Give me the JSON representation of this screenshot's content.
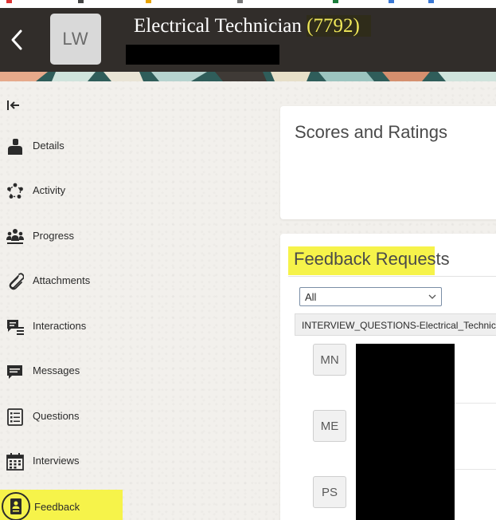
{
  "header": {
    "avatar_initials": "LW",
    "job_title": "Electrical Technician",
    "job_id": "7792",
    "paren_open": "(",
    "paren_close": ")"
  },
  "sidebar": {
    "items": [
      {
        "label": "Details",
        "icon": "person-icon"
      },
      {
        "label": "Activity",
        "icon": "activity-icon"
      },
      {
        "label": "Progress",
        "icon": "people-icon"
      },
      {
        "label": "Attachments",
        "icon": "paperclip-icon"
      },
      {
        "label": "Interactions",
        "icon": "interactions-icon"
      },
      {
        "label": "Messages",
        "icon": "message-icon"
      },
      {
        "label": "Questions",
        "icon": "checklist-icon"
      },
      {
        "label": "Interviews",
        "icon": "calendar-icon"
      },
      {
        "label": "Feedback",
        "icon": "feedback-icon"
      }
    ]
  },
  "scores": {
    "title": "Scores and Ratings"
  },
  "feedback": {
    "title": "Feedback Requests",
    "filter_value": "All",
    "question_label": "INTERVIEW_QUESTIONS-Electrical_Technician",
    "reviewers": [
      "MN",
      "ME",
      "PS"
    ]
  },
  "colors": {
    "header_bg": "#312d2a",
    "highlight": "#f6f34a",
    "job_id_color": "#f0e85a"
  }
}
